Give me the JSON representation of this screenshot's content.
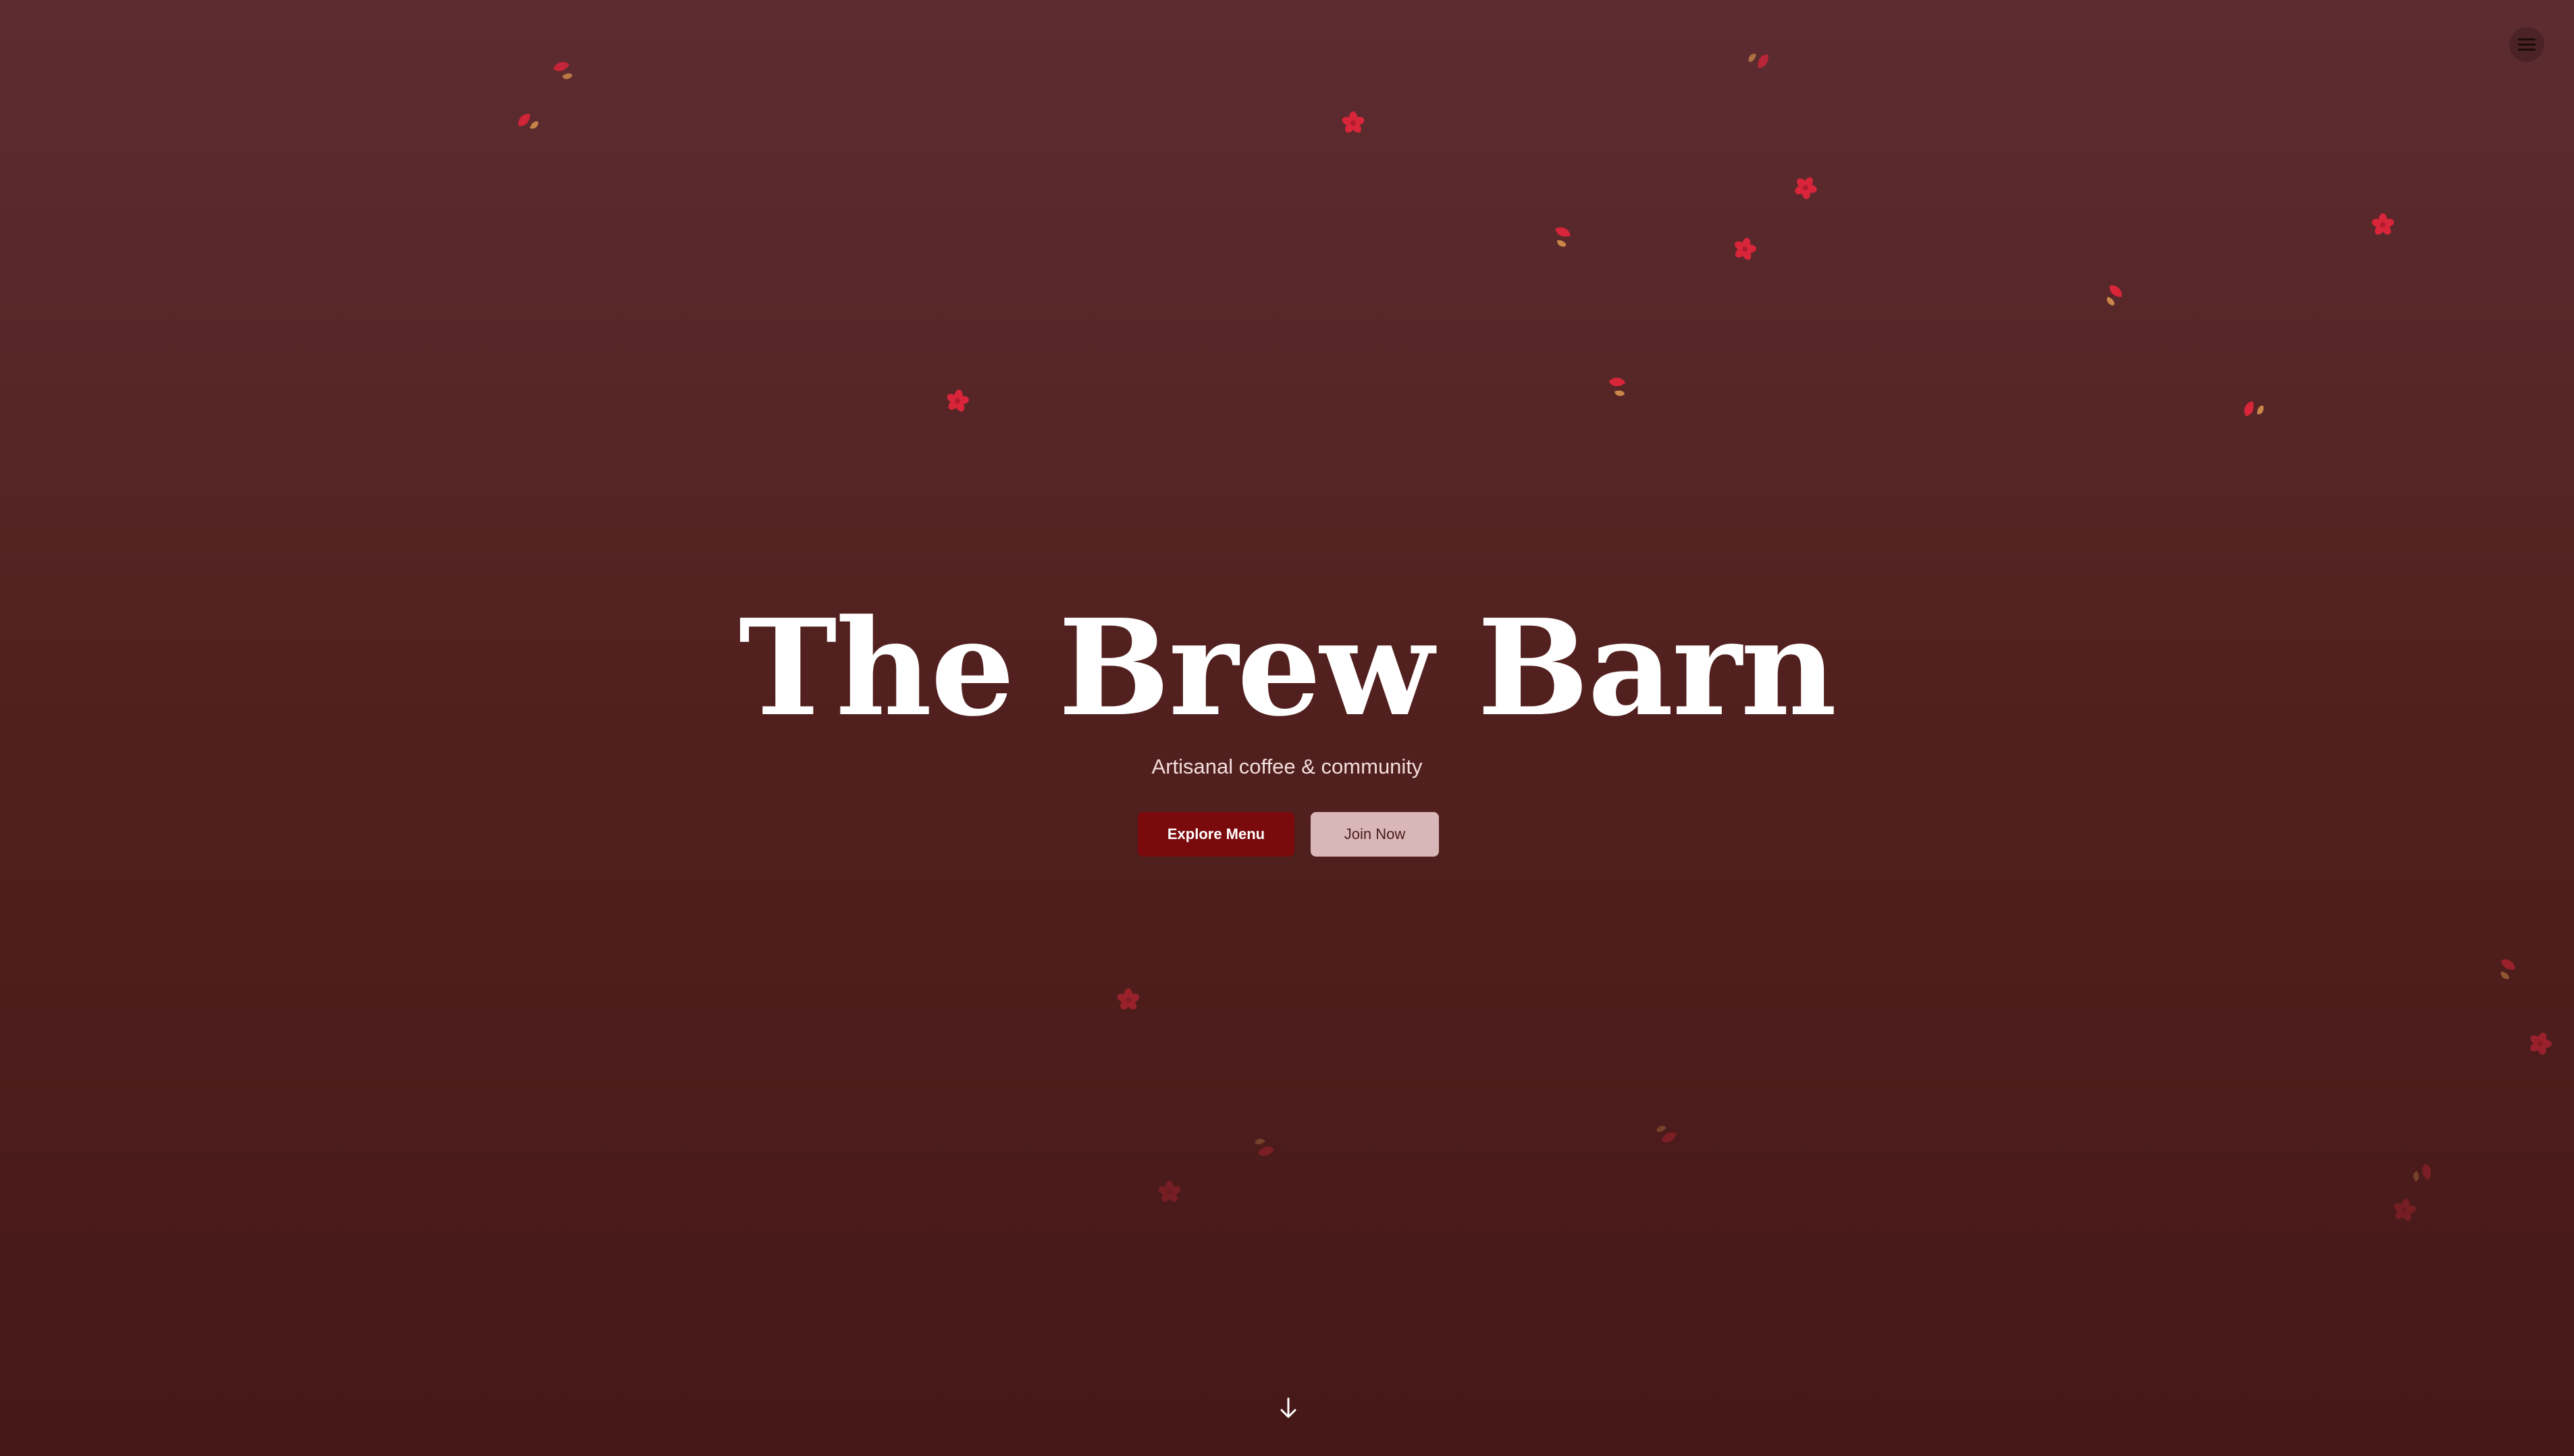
{
  "hero": {
    "title": "The Brew Barn",
    "tagline": "Artisanal coffee & community",
    "primary_button": "Explore Menu",
    "secondary_button": "Join Now"
  },
  "header": {
    "menu_icon": "hamburger-menu-icon"
  },
  "footer": {
    "scroll_icon": "arrow-down-icon"
  },
  "decorations": {
    "icon": "falling-leaf-icon"
  },
  "colors": {
    "background_top": "#5d2c31",
    "background_bottom": "#461818",
    "primary_button": "#7b0a0c",
    "secondary_button": "#d9b7b8",
    "leaf_red": "#d8253a",
    "leaf_gold": "#c9874a"
  }
}
